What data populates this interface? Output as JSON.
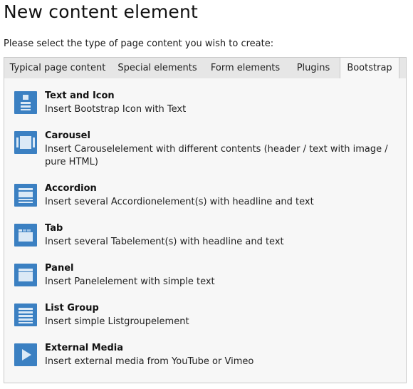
{
  "page": {
    "title": "New content element",
    "instruction": "Please select the type of page content you wish to create:"
  },
  "tabs": [
    {
      "label": "Typical page content",
      "active": false
    },
    {
      "label": "Special elements",
      "active": false
    },
    {
      "label": "Form elements",
      "active": false
    },
    {
      "label": "Plugins",
      "active": false
    },
    {
      "label": "Bootstrap",
      "active": true
    }
  ],
  "items": [
    {
      "title": "Text and Icon",
      "description": "Insert Bootstrap Icon with Text",
      "icon": "text-icon-icon"
    },
    {
      "title": "Carousel",
      "description": "Insert Carouselelement with different contents (header / text with image / pure HTML)",
      "icon": "carousel-icon"
    },
    {
      "title": "Accordion",
      "description": "Insert several Accordionelement(s) with headline and text",
      "icon": "accordion-icon"
    },
    {
      "title": "Tab",
      "description": "Insert several Tabelement(s) with headline and text",
      "icon": "tab-icon"
    },
    {
      "title": "Panel",
      "description": "Insert Panelelement with simple text",
      "icon": "panel-icon"
    },
    {
      "title": "List Group",
      "description": "Insert simple Listgroupelement",
      "icon": "list-group-icon"
    },
    {
      "title": "External Media",
      "description": "Insert external media from YouTube or Vimeo",
      "icon": "play-icon"
    }
  ],
  "colors": {
    "icon_background": "#3b80c2",
    "tab_bar": "#e6e6e6",
    "panel": "#f7f7f7",
    "border": "#c9c9c9"
  }
}
